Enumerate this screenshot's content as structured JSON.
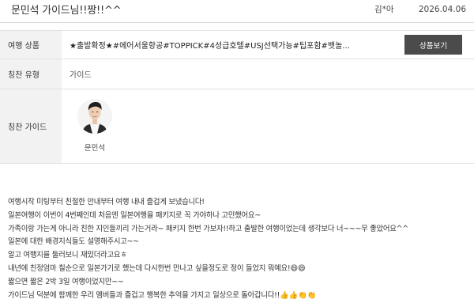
{
  "header": {
    "title": "문민석 가이드님!!짱!!^^",
    "author": "김*아",
    "date": "2026.04.06"
  },
  "info": {
    "product": {
      "label": "여행 상품",
      "value": "★출발확정★#에어서울항공#TOPPICK#4성급호텔#USJ선택가능#팁포함#뱃놀...",
      "button_label": "상품보기"
    },
    "praise_type": {
      "label": "칭찬 유형",
      "value": "가이드"
    },
    "praise_guide": {
      "label": "칭찬 가이드",
      "guide_name": "문민석"
    }
  },
  "review": {
    "lines": [
      "여행시작 미팅부터 친절한 안내부터 여행 내내 즐겁게 보냈습니다!",
      "일본여행이 이번이 4번째인데 처음엔 일본여행을 패키지로 꼭 가야하나 고민했어요~",
      "가족이랑 가는게 아니라 친한 지인들끼리 가는거라~ 패키지 한번 가보자!!하고 출발한 여행이었는데 생각보다 너~~~무 좋았어요^^",
      "일본에 대한 배경지식들도 설명해주시고~~",
      "알고 여행지를 둘러보니 재밌더라고요ㅎ",
      "내년에 친정엄마 칠순으로 일본가기로 했는데 다시한번 만나고 싶을정도로 정이 들었지 뭐예요!😄😄",
      "짧으면 짧은 2박 3일 여행이었지만~~",
      "가이드님 덕분에 함께한 우리 멤버들과 즐겁고 행복한 추억을 가지고 일상으로 돌아갑니다!!👍👍👏👏"
    ]
  }
}
